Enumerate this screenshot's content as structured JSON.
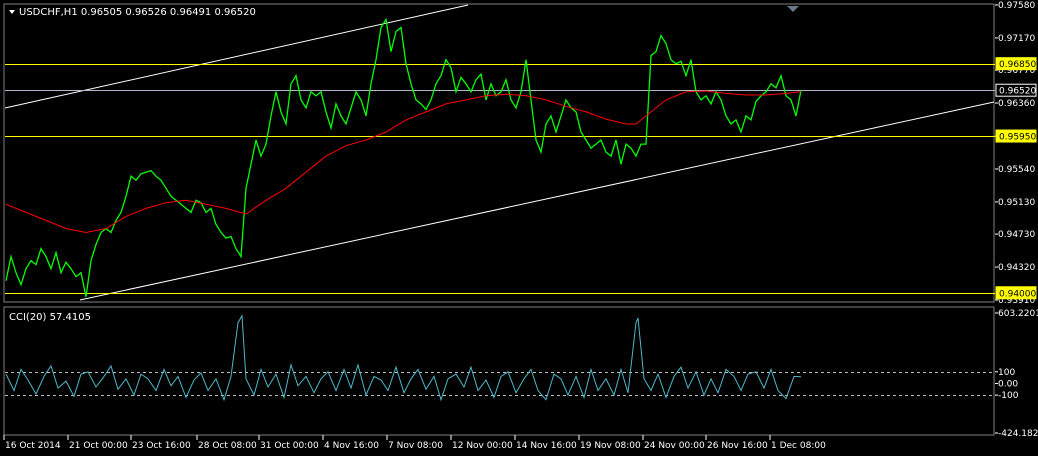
{
  "chart_data": [
    {
      "type": "line",
      "title": "USDCHF,H1  0.96505 0.96526 0.96491 0.96520",
      "symbol": "USDCHF,H1",
      "ohlc": {
        "open": "0.96505",
        "high": "0.96526",
        "low": "0.96491",
        "close": "0.96520"
      },
      "ylim": [
        0.9391,
        0.9758
      ],
      "y_ticks": [
        "0.97580",
        "0.97170",
        "0.96770",
        "0.96360",
        "0.95950",
        "0.95540",
        "0.95130",
        "0.94730",
        "0.94320",
        "0.93910"
      ],
      "x_ticks": [
        "16 Oct 2014",
        "21 Oct 00:00",
        "23 Oct 16:00",
        "28 Oct 08:00",
        "31 Oct 00:00",
        "4 Nov 16:00",
        "7 Nov 08:00",
        "12 Nov 00:00",
        "14 Nov 16:00",
        "19 Nov 08:00",
        "24 Nov 00:00",
        "26 Nov 16:00",
        "1 Dec 08:00"
      ],
      "horizontal_levels": [
        {
          "value": 0.9685,
          "label": "0.96850",
          "color": "#ffff00"
        },
        {
          "value": 0.9595,
          "label": "0.95950",
          "color": "#ffff00"
        },
        {
          "value": 0.94,
          "label": "0.94000",
          "color": "#ffff00"
        },
        {
          "value": 0.9652,
          "label": "0.96520",
          "color": "#aab8c8"
        }
      ],
      "series": [
        {
          "color": "#00ff00",
          "x": [
            0,
            5,
            10,
            15,
            20,
            25,
            30,
            35,
            40,
            45,
            50,
            55,
            60,
            65,
            70,
            75,
            80,
            85,
            90,
            95,
            100,
            105,
            110,
            115,
            120,
            125,
            130,
            135,
            140,
            145,
            150,
            155,
            160,
            165,
            170,
            175,
            180,
            185,
            190,
            195,
            200,
            205,
            210,
            215,
            220,
            225,
            230,
            235,
            240,
            245,
            250,
            255,
            260,
            265,
            270,
            275,
            280,
            285,
            290,
            295,
            300,
            305,
            310,
            315,
            320,
            325,
            330,
            335,
            340,
            345,
            350,
            355,
            360,
            365,
            370,
            375,
            380,
            385,
            390,
            395,
            400,
            405,
            410,
            415,
            420,
            425,
            430,
            435,
            440,
            445,
            450,
            455,
            460,
            465,
            470,
            475,
            480,
            485,
            490,
            495,
            500,
            505,
            510,
            515,
            520,
            525,
            530,
            535,
            540,
            545,
            550,
            555,
            560,
            565,
            570,
            575,
            580,
            585,
            590,
            595,
            600,
            605,
            610,
            615,
            620,
            625,
            630,
            635,
            640,
            645,
            650,
            655,
            660,
            665,
            670,
            675,
            680,
            685,
            690,
            695,
            700,
            705,
            710,
            715,
            720,
            725,
            730,
            735,
            740,
            745,
            750,
            755,
            760,
            765,
            770,
            775,
            780,
            785,
            790,
            795
          ],
          "values": [
            0.9415,
            0.9445,
            0.9425,
            0.941,
            0.943,
            0.944,
            0.9435,
            0.9455,
            0.9445,
            0.943,
            0.945,
            0.9425,
            0.9438,
            0.943,
            0.942,
            0.9425,
            0.9395,
            0.944,
            0.946,
            0.9475,
            0.948,
            0.9475,
            0.949,
            0.95,
            0.952,
            0.9545,
            0.954,
            0.9548,
            0.955,
            0.9552,
            0.9545,
            0.954,
            0.953,
            0.952,
            0.9515,
            0.951,
            0.9505,
            0.95,
            0.9515,
            0.9512,
            0.95,
            0.9505,
            0.9485,
            0.9475,
            0.9468,
            0.947,
            0.9455,
            0.9445,
            0.953,
            0.956,
            0.959,
            0.957,
            0.9585,
            0.962,
            0.965,
            0.9625,
            0.961,
            0.966,
            0.967,
            0.964,
            0.963,
            0.965,
            0.9645,
            0.965,
            0.9625,
            0.9605,
            0.9635,
            0.962,
            0.961,
            0.963,
            0.965,
            0.964,
            0.962,
            0.966,
            0.969,
            0.973,
            0.974,
            0.97,
            0.9725,
            0.973,
            0.9685,
            0.966,
            0.964,
            0.9635,
            0.9628,
            0.964,
            0.966,
            0.967,
            0.969,
            0.968,
            0.965,
            0.9668,
            0.966,
            0.965,
            0.9665,
            0.9672,
            0.964,
            0.966,
            0.9645,
            0.965,
            0.9665,
            0.964,
            0.963,
            0.965,
            0.969,
            0.964,
            0.959,
            0.9575,
            0.961,
            0.962,
            0.96,
            0.962,
            0.964,
            0.963,
            0.9625,
            0.96,
            0.959,
            0.958,
            0.9585,
            0.959,
            0.9575,
            0.957,
            0.959,
            0.956,
            0.9585,
            0.958,
            0.957,
            0.9585,
            0.9585,
            0.9695,
            0.97,
            0.972,
            0.971,
            0.969,
            0.9685,
            0.9688,
            0.967,
            0.969,
            0.965,
            0.964,
            0.9645,
            0.9635,
            0.965,
            0.964,
            0.962,
            0.961,
            0.9615,
            0.96,
            0.962,
            0.9615,
            0.9638,
            0.9645,
            0.965,
            0.966,
            0.9655,
            0.967,
            0.9645,
            0.964,
            0.962,
            0.9652
          ]
        },
        {
          "color": "#ff0000",
          "x": [
            0,
            20,
            40,
            60,
            80,
            100,
            120,
            140,
            160,
            180,
            200,
            220,
            240,
            260,
            280,
            300,
            320,
            340,
            360,
            380,
            400,
            420,
            440,
            460,
            480,
            500,
            520,
            540,
            560,
            580,
            600,
            620,
            630,
            640,
            660,
            680,
            700,
            720,
            740,
            760,
            780,
            795
          ],
          "values": [
            0.951,
            0.95,
            0.949,
            0.948,
            0.9475,
            0.948,
            0.9495,
            0.9505,
            0.9512,
            0.9515,
            0.951,
            0.9505,
            0.9498,
            0.9515,
            0.953,
            0.955,
            0.957,
            0.9583,
            0.959,
            0.96,
            0.9615,
            0.9625,
            0.9635,
            0.964,
            0.9645,
            0.9647,
            0.9645,
            0.964,
            0.9632,
            0.9625,
            0.9616,
            0.961,
            0.961,
            0.962,
            0.964,
            0.965,
            0.9651,
            0.9648,
            0.9646,
            0.9646,
            0.9648,
            0.965
          ]
        }
      ]
    },
    {
      "type": "line",
      "title": "CCI(20) 57.4105",
      "indicator": "CCI(20)",
      "current_value": "57.4105",
      "ylim": [
        -424.1821,
        603.2201
      ],
      "y_ticks": [
        "603.2201",
        "100",
        "0.00",
        "-100",
        "-424.1821"
      ],
      "levels": [
        100,
        -100
      ],
      "series": [
        {
          "color": "#4fb8c8",
          "x": [
            0,
            8,
            15,
            22,
            30,
            38,
            45,
            52,
            60,
            68,
            75,
            82,
            90,
            98,
            105,
            112,
            120,
            128,
            135,
            142,
            150,
            158,
            165,
            172,
            180,
            188,
            195,
            202,
            210,
            218,
            225,
            232,
            236,
            240,
            248,
            255,
            262,
            270,
            278,
            285,
            292,
            300,
            308,
            315,
            322,
            330,
            338,
            345,
            352,
            360,
            368,
            375,
            382,
            390,
            398,
            405,
            412,
            420,
            428,
            435,
            442,
            450,
            458,
            465,
            472,
            480,
            488,
            495,
            502,
            510,
            518,
            525,
            532,
            540,
            548,
            555,
            562,
            570,
            578,
            585,
            592,
            600,
            608,
            615,
            622,
            630,
            632,
            638,
            645,
            652,
            660,
            668,
            675,
            682,
            690,
            698,
            705,
            712,
            720,
            728,
            735,
            742,
            750,
            758,
            765,
            772,
            780,
            788,
            795
          ],
          "values": [
            80,
            -60,
            120,
            30,
            -90,
            60,
            150,
            -40,
            20,
            -110,
            80,
            100,
            -30,
            60,
            150,
            -50,
            40,
            -100,
            80,
            40,
            -60,
            120,
            -20,
            60,
            -120,
            30,
            90,
            -60,
            40,
            -140,
            60,
            520,
            580,
            40,
            -100,
            120,
            -30,
            80,
            -120,
            160,
            -20,
            60,
            -80,
            40,
            100,
            -60,
            120,
            -40,
            160,
            -100,
            60,
            30,
            -60,
            140,
            -80,
            40,
            120,
            -50,
            60,
            -140,
            40,
            80,
            -30,
            140,
            -60,
            30,
            -120,
            60,
            100,
            -80,
            40,
            120,
            -60,
            -140,
            80,
            40,
            -100,
            60,
            -120,
            120,
            -60,
            40,
            -100,
            120,
            -80,
            520,
            560,
            40,
            -60,
            80,
            -120,
            60,
            140,
            -40,
            100,
            -100,
            40,
            -80,
            120,
            60,
            -60,
            80,
            100,
            -40,
            120,
            -60,
            -130,
            60,
            57
          ]
        }
      ]
    }
  ]
}
